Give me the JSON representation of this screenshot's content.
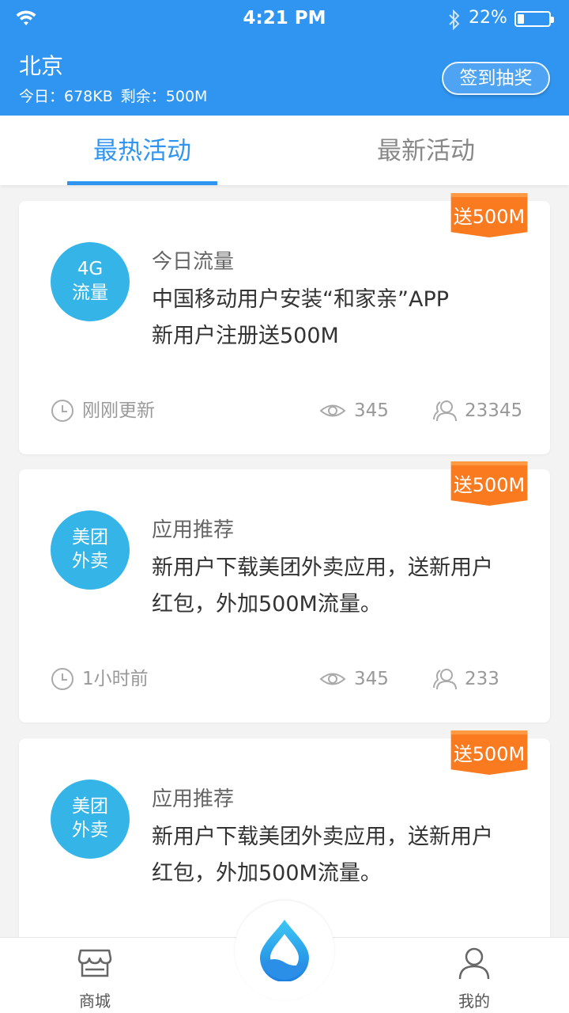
{
  "status_bar": {
    "time": "4:21 PM",
    "battery_percent": "22%",
    "battery_level": 0.22,
    "icons": [
      "wifi-icon",
      "bluetooth-icon",
      "battery-icon"
    ]
  },
  "header": {
    "city": "北京",
    "today_usage": "今日：678KB",
    "remaining": "剩余：500M",
    "sign_button": "签到抽奖"
  },
  "tabs": [
    {
      "label": "最热活动",
      "active": true
    },
    {
      "label": "最新活动",
      "active": false
    }
  ],
  "cards": [
    {
      "ribbon": "送500M",
      "badge_line1": "4G",
      "badge_line2": "流量",
      "title": "今日流量",
      "desc_line1": "中国移动用户安装“和家亲”APP",
      "desc_line2": "新用户注册送500M",
      "time": "刚刚更新",
      "views": "345",
      "participants": "23345"
    },
    {
      "ribbon": "送500M",
      "badge_line1": "美团",
      "badge_line2": "外卖",
      "title": "应用推荐",
      "desc_line1": "新用户下载美团外卖应用，送新用户",
      "desc_line2": "红包，外加500M流量。",
      "time": "1小时前",
      "views": "345",
      "participants": "233"
    },
    {
      "ribbon": "送500M",
      "badge_line1": "美团",
      "badge_line2": "外卖",
      "title": "应用推荐",
      "desc_line1": "新用户下载美团外卖应用，送新用户",
      "desc_line2": "红包，外加500M流量。"
    }
  ],
  "bottom_nav": {
    "shop": "商城",
    "mine": "我的",
    "center_icon": "water-drop-icon"
  },
  "colors": {
    "primary": "#2f95f0",
    "badge": "#35b5e7",
    "ribbon": "#f97a1f"
  }
}
